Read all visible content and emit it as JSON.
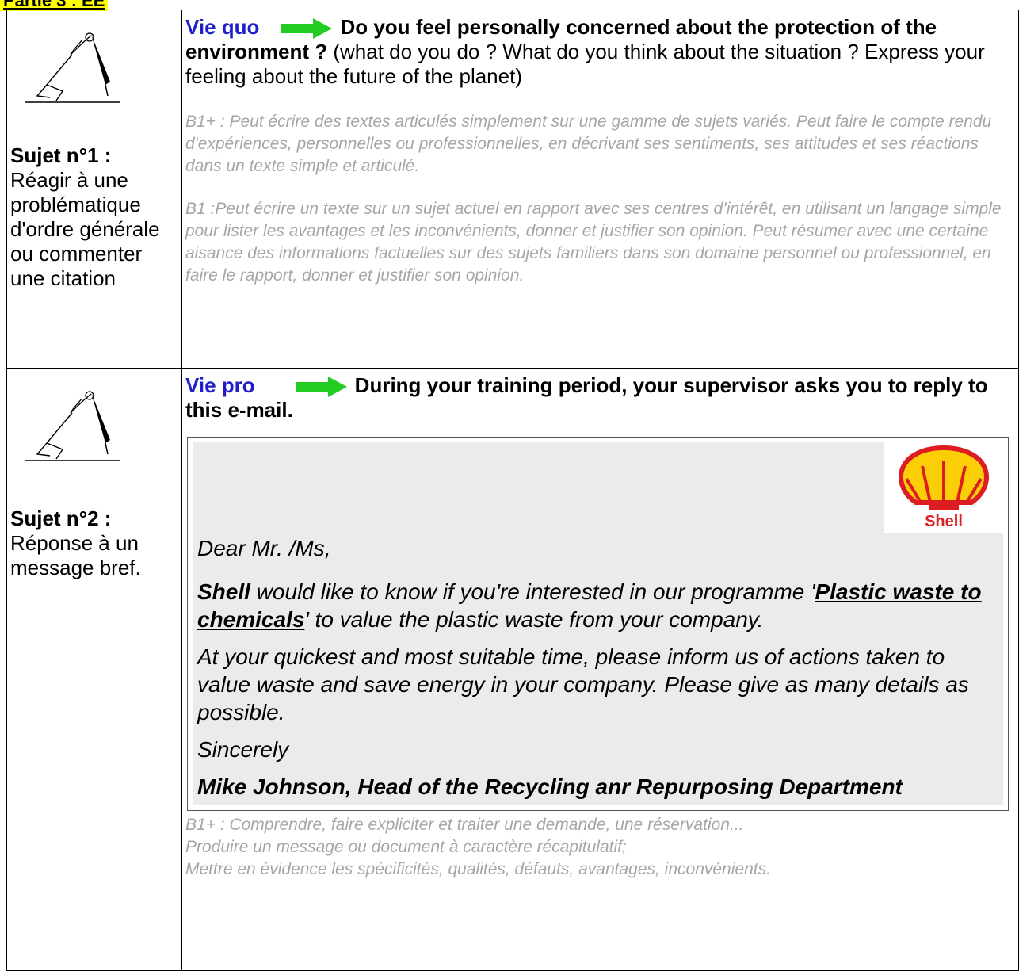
{
  "header": {
    "title": "Partie 3 : EE"
  },
  "section1": {
    "subject_title": "Sujet n°1 :",
    "subject_desc": "Réagir à une problématique d'ordre générale ou commenter une citation",
    "tag": "Vie quo",
    "question_bold": "Do you feel personally concerned about the protection of the  environment ?",
    "question_normal": " (what do you do ? What do you think about the situation ? Express your feeling about the future of the planet)",
    "criteria_b1plus": "B1+ : Peut écrire des textes articulés simplement sur une gamme de sujets variés. Peut faire le compte rendu d'expériences, personnelles ou professionnelles, en décrivant ses sentiments, ses attitudes et ses réactions dans un texte simple et articulé.",
    "criteria_b1": "B1 :Peut écrire un texte sur un sujet actuel en rapport avec ses centres d’intérêt, en utilisant un langage simple pour lister les avantages et les inconvénients, donner et justifier son opinion. Peut résumer avec une certaine aisance des informations factuelles sur des sujets familiers dans son domaine personnel ou professionnel, en faire le rapport, donner et justifier son opinion."
  },
  "section2": {
    "subject_title": "Sujet n°2 :",
    "subject_desc": "Réponse à un message bref.",
    "tag": "Vie pro",
    "question_bold": "During your training period, your supervisor asks you to reply to this e-mail.",
    "email": {
      "logo_text": "Shell",
      "greeting": "Dear Mr. /Ms,",
      "p1_company": "Shell",
      "p1_text1": "  would like to know if you're interested in our programme  '",
      "p1_link": "Plastic waste to chemicals",
      "p1_text2": "' to value the plastic waste from your company.",
      "p2": "At your quickest and most suitable time, please inform us of actions taken to value waste and save energy in your company.  Please give as many details as possible.",
      "closing": "Sincerely",
      "signature": "Mike Johnson, Head of the Recycling anr Repurposing Department"
    },
    "criteria_lines": [
      "B1+ : Comprendre, faire expliciter et traiter une demande, une réservation...",
      "Produire un message ou document à caractère récapitulatif;",
      "Mettre en évidence les spécificités, qualités, défauts, avantages, inconvénients."
    ]
  },
  "colors": {
    "tag": "#1f1fc8",
    "arrow": "#22cc22",
    "criteria": "#a6a6a6",
    "email_bg": "#ebebeb",
    "header_bg": "#ffff00"
  },
  "icons": {
    "writer": "stick-figure-with-pen-icon",
    "arrow": "green-arrow-icon",
    "logo": "shell-logo"
  }
}
